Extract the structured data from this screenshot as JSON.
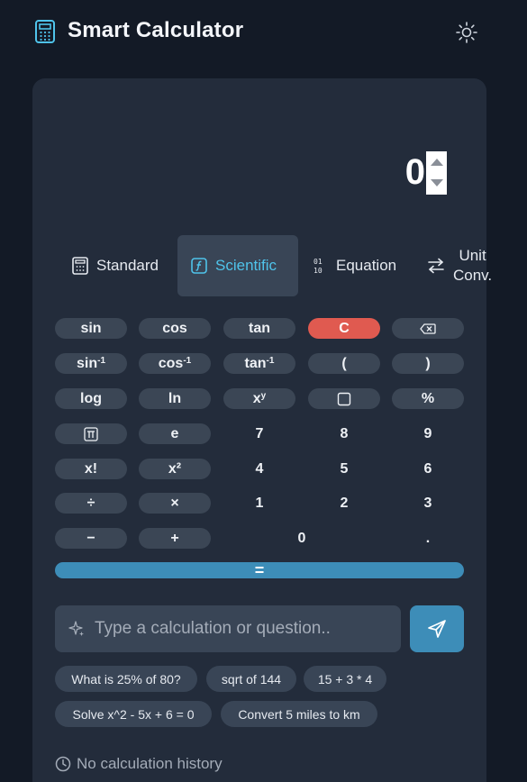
{
  "app": {
    "title": "Smart Calculator"
  },
  "display": {
    "value": "0"
  },
  "tabs": [
    {
      "label": "Standard",
      "icon": "calculator-icon",
      "active": false
    },
    {
      "label": "Scientific",
      "icon": "function-icon",
      "active": true
    },
    {
      "label": "Equation",
      "icon": "binary-icon",
      "active": false
    },
    {
      "label": "Unit\nConv.",
      "icon": "swap-arrows-icon",
      "active": false
    }
  ],
  "keys": {
    "sin": "sin",
    "cos": "cos",
    "tan": "tan",
    "clear": "C",
    "asin": "sin",
    "acos": "cos",
    "atan": "tan",
    "inv": "-1",
    "open_paren": "(",
    "close_paren": ")",
    "log": "log",
    "ln": "ln",
    "pow_base": "x",
    "pow_exp": "y",
    "percent": "%",
    "e": "e",
    "factorial": "x!",
    "square": "x²",
    "seven": "7",
    "eight": "8",
    "nine": "9",
    "four": "4",
    "five": "5",
    "six": "6",
    "divide": "÷",
    "multiply": "×",
    "one": "1",
    "two": "2",
    "three": "3",
    "minus": "−",
    "plus": "+",
    "zero": "0",
    "dot": ".",
    "equals": "="
  },
  "ask": {
    "placeholder": "Type a calculation or question.."
  },
  "suggestions": [
    "What is 25% of 80?",
    "sqrt of 144",
    "15 + 3 * 4",
    "Solve x^2 - 5x + 6 = 0",
    "Convert 5 miles to km"
  ],
  "history": {
    "empty_text": "No calculation history"
  },
  "colors": {
    "background": "#131a26",
    "card": "#232c3b",
    "key": "#3b4655",
    "accent": "#4fc3ea",
    "clear": "#e05a50",
    "equals": "#3d8db8"
  }
}
